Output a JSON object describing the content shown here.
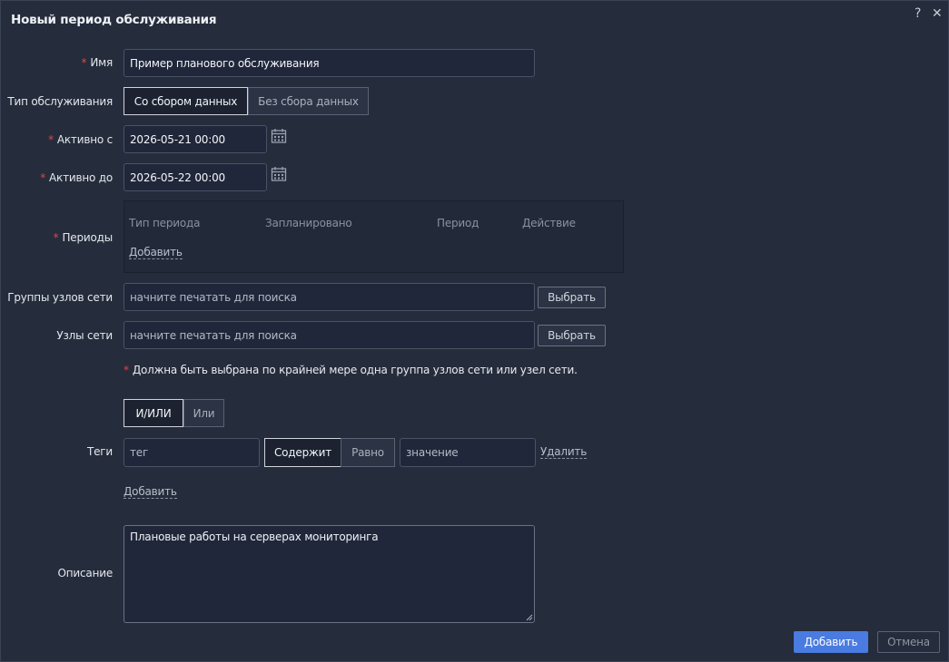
{
  "dialog": {
    "title": "Новый период обслуживания",
    "help_icon": "?",
    "close_icon": "✕"
  },
  "form": {
    "name": {
      "label": "Имя",
      "value": "Пример планового обслуживания"
    },
    "maintenance_type": {
      "label": "Тип обслуживания",
      "options": [
        "Со сбором данных",
        "Без сбора данных"
      ],
      "selected": "Со сбором данных"
    },
    "active_since": {
      "label": "Активно с",
      "value": "2026-05-21 00:00"
    },
    "active_till": {
      "label": "Активно до",
      "value": "2026-05-22 00:00"
    },
    "periods": {
      "label": "Периоды",
      "columns": [
        "Тип периода",
        "Запланировано",
        "Период",
        "Действие"
      ],
      "add_link": "Добавить"
    },
    "host_groups": {
      "label": "Группы узлов сети",
      "placeholder": "начните печатать для поиска",
      "button": "Выбрать"
    },
    "hosts": {
      "label": "Узлы сети",
      "placeholder": "начните печатать для поиска",
      "button": "Выбрать"
    },
    "note": "Должна быть выбрана по крайней мере одна группа узлов сети или узел сети.",
    "tags": {
      "label": "Теги",
      "evaltype_options": [
        "И/ИЛИ",
        "Или"
      ],
      "evaltype_selected": "И/ИЛИ",
      "row": {
        "tag_placeholder": "тег",
        "operator_options": [
          "Содержит",
          "Равно"
        ],
        "operator_selected": "Содержит",
        "value_placeholder": "значение",
        "remove_link": "Удалить"
      },
      "add_link": "Добавить"
    },
    "description": {
      "label": "Описание",
      "value": "Плановые работы на серверах мониторинга"
    }
  },
  "footer": {
    "submit": "Добавить",
    "cancel": "Отмена"
  },
  "colors": {
    "accent": "#4a7be0",
    "required": "#e0464a",
    "background": "#252c3b"
  },
  "icons": [
    "help-icon",
    "close-icon",
    "calendar-icon",
    "resize-grip-icon"
  ]
}
